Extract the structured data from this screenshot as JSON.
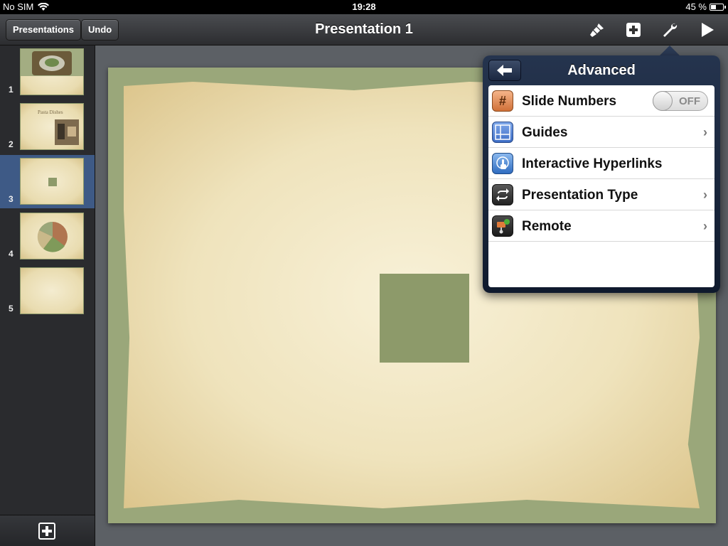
{
  "status": {
    "carrier": "No SIM",
    "time": "19:28",
    "battery": "45 %",
    "battery_level": 0.45
  },
  "toolbar": {
    "presentations_label": "Presentations",
    "undo_label": "Undo",
    "title": "Presentation 1",
    "icons": [
      "paintbrush-icon",
      "add-icon",
      "wrench-icon",
      "play-icon"
    ]
  },
  "sidebar": {
    "slides": [
      {
        "number": "1"
      },
      {
        "number": "2",
        "caption": "Pasta Dishes"
      },
      {
        "number": "3"
      },
      {
        "number": "4"
      },
      {
        "number": "5"
      }
    ],
    "selected_index": 2,
    "add_icon": "add-slide-icon"
  },
  "popover": {
    "title": "Advanced",
    "back_icon": "back-arrow-icon",
    "items": [
      {
        "label": "Slide Numbers",
        "icon": "hash-icon",
        "accessory": "toggle",
        "toggle_state": "OFF"
      },
      {
        "label": "Guides",
        "icon": "guides-icon",
        "accessory": "chevron"
      },
      {
        "label": "Interactive Hyperlinks",
        "icon": "hand-pointer-icon",
        "accessory": "none"
      },
      {
        "label": "Presentation Type",
        "icon": "loop-arrows-icon",
        "accessory": "chevron"
      },
      {
        "label": "Remote",
        "icon": "remote-icon",
        "accessory": "chevron"
      }
    ],
    "chevron": "›"
  },
  "colors": {
    "selection": "#3e5a86",
    "slide_border": "#9aa77a",
    "shape": "#8d9a6a"
  }
}
